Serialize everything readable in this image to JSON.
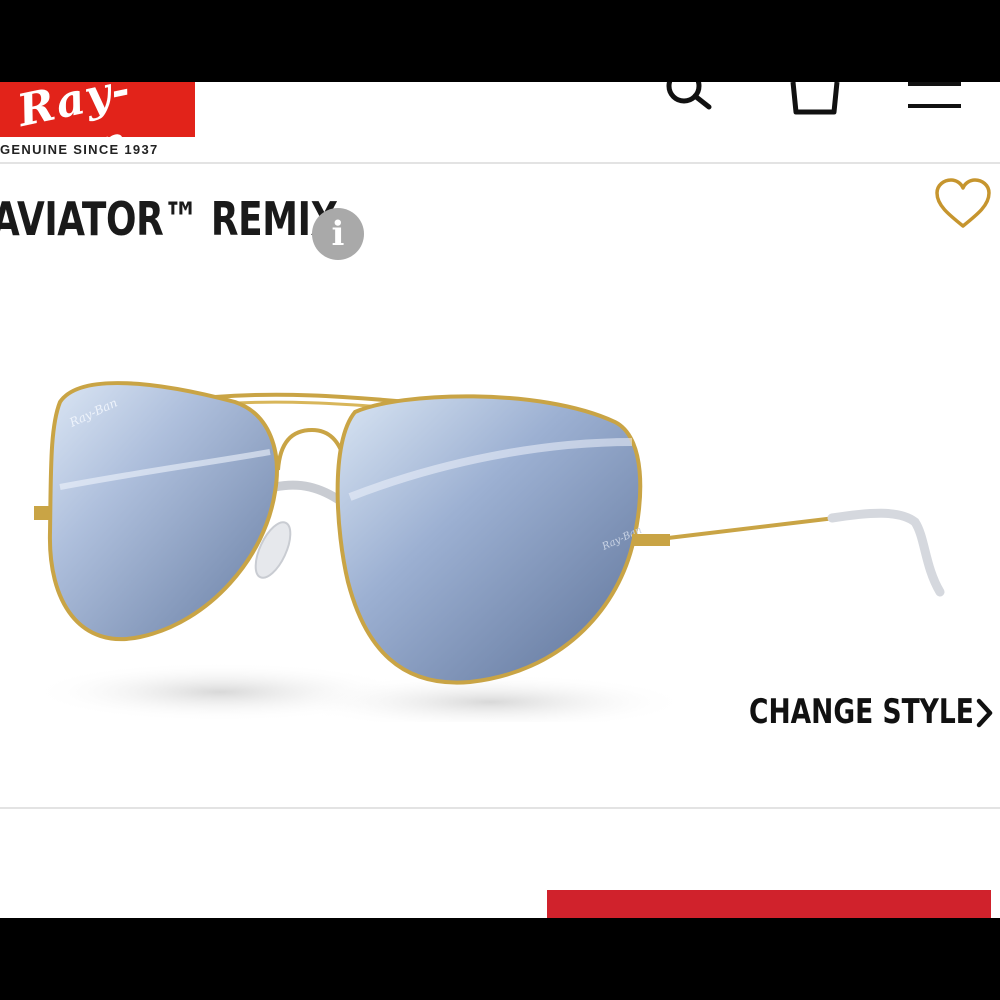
{
  "header": {
    "logo_text": "Ray-Ban",
    "tagline": "GENUINE SINCE 1937",
    "icons": [
      "search-icon",
      "shopping-bag-icon",
      "menu-icon"
    ]
  },
  "product": {
    "title": "AVIATOR™ REMIX",
    "info_label": "i",
    "wishlist_icon": "heart-icon",
    "change_style_label": "CHANGE STYLE",
    "lens_brand_mark": "Ray-Ban"
  },
  "colors": {
    "brand_red": "#e2231a",
    "cta_red": "#d0222c",
    "wishlist_gold": "#c6952e",
    "info_gray": "#a9a9a9"
  }
}
